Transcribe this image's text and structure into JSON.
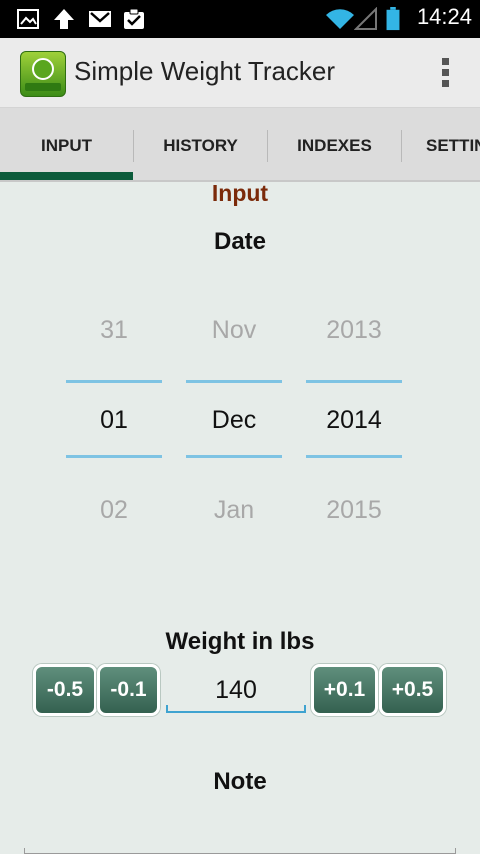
{
  "status_bar": {
    "time": "14:24",
    "icons": [
      "image-icon",
      "upload-icon",
      "gmail-icon",
      "clipboard-check-icon",
      "wifi-icon",
      "signal-icon",
      "battery-icon"
    ]
  },
  "app": {
    "title": "Simple Weight Tracker",
    "icon": "weight-scale-app-icon"
  },
  "tabs": [
    {
      "label": "INPUT",
      "active": true
    },
    {
      "label": "HISTORY",
      "active": false
    },
    {
      "label": "INDEXES",
      "active": false
    },
    {
      "label": "SETTIN",
      "active": false
    }
  ],
  "input": {
    "title": "Input",
    "date_label": "Date",
    "date_picker": {
      "day": {
        "prev": "31",
        "selected": "01",
        "next": "02"
      },
      "month": {
        "prev": "Nov",
        "selected": "Dec",
        "next": "Jan"
      },
      "year": {
        "prev": "2013",
        "selected": "2014",
        "next": "2015"
      }
    },
    "weight_label": "Weight in lbs",
    "weight_value": "140",
    "buttons": {
      "minus_half": "-0.5",
      "minus_tenth": "-0.1",
      "plus_tenth": "+0.1",
      "plus_half": "+0.5"
    },
    "note_label": "Note",
    "note_value": ""
  },
  "colors": {
    "tab_indicator": "#0c5b3b",
    "input_title": "#7b2a0a",
    "button_bg": "#466f5f",
    "picker_line": "#7ec3e3"
  }
}
